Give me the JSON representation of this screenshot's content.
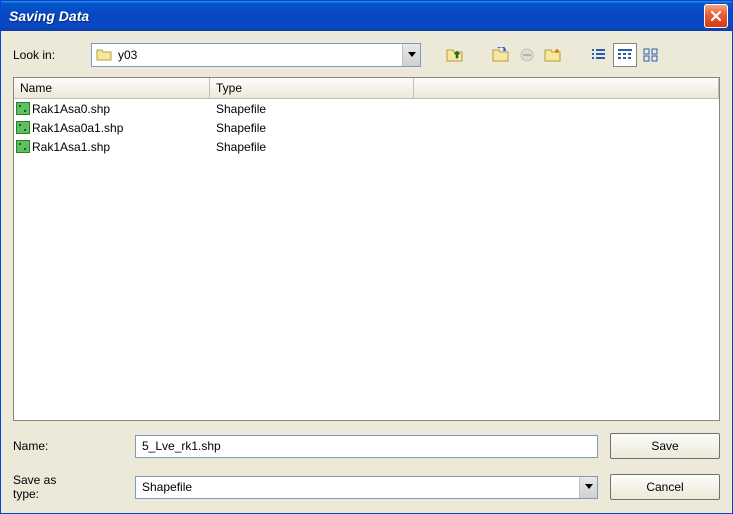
{
  "window": {
    "title": "Saving Data"
  },
  "toolbar": {
    "look_in_label": "Look in:",
    "current_folder": "y03"
  },
  "columns": {
    "name": "Name",
    "type": "Type"
  },
  "files": [
    {
      "name": "Rak1Asa0.shp",
      "type": "Shapefile"
    },
    {
      "name": "Rak1Asa0a1.shp",
      "type": "Shapefile"
    },
    {
      "name": "Rak1Asa1.shp",
      "type": "Shapefile"
    }
  ],
  "form": {
    "name_label": "Name:",
    "name_value": "5_Lve_rk1.shp",
    "type_label": "Save as type:",
    "type_value": "Shapefile",
    "save_label": "Save",
    "cancel_label": "Cancel"
  }
}
